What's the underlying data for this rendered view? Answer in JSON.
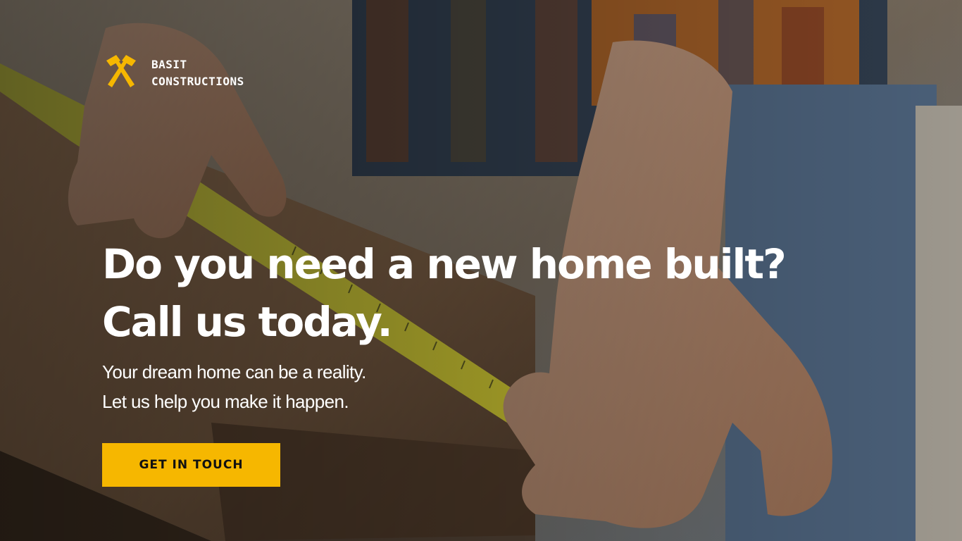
{
  "brand": {
    "line1": "BASIT",
    "line2": "CONSTRUCTIONS",
    "logo_icon": "crossed-hammers-icon",
    "accent_color": "#f6b700"
  },
  "hero": {
    "headline_line1": "Do you need a new home built?",
    "headline_line2": "Call us today.",
    "subtext_line1": "Your dream home can be a reality.",
    "subtext_line2": "Let us help you make it happen.",
    "cta_label": "GET IN TOUCH"
  }
}
